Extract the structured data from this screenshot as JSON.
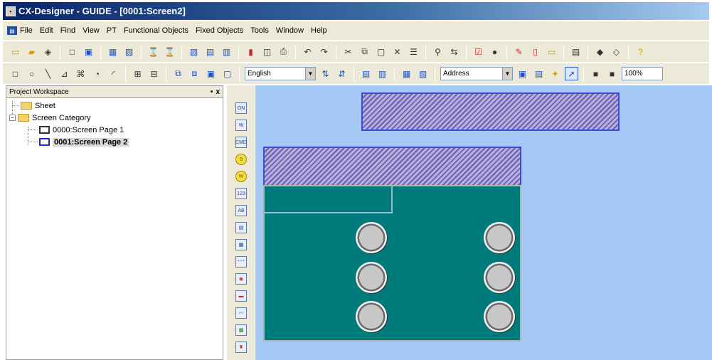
{
  "window": {
    "title": "CX-Designer - GUIDE - [0001:Screen2]"
  },
  "menu": [
    "File",
    "Edit",
    "Find",
    "View",
    "PT",
    "Functional Objects",
    "Fixed Objects",
    "Tools",
    "Window",
    "Help"
  ],
  "toolbar2": {
    "language_value": "English",
    "address_value": "Address",
    "zoom_value": "100%"
  },
  "workspace": {
    "title": "Project Workspace",
    "close_glyph": "x",
    "pin_glyph": "•",
    "tree": {
      "sheet": "Sheet",
      "category": "Screen Category",
      "page1": "0000:Screen Page 1",
      "page2": "0001:Screen Page 2"
    }
  },
  "canvas": {
    "background_color": "#a6c8f5",
    "panel_color": "#007b7b",
    "knob_count": 6
  }
}
